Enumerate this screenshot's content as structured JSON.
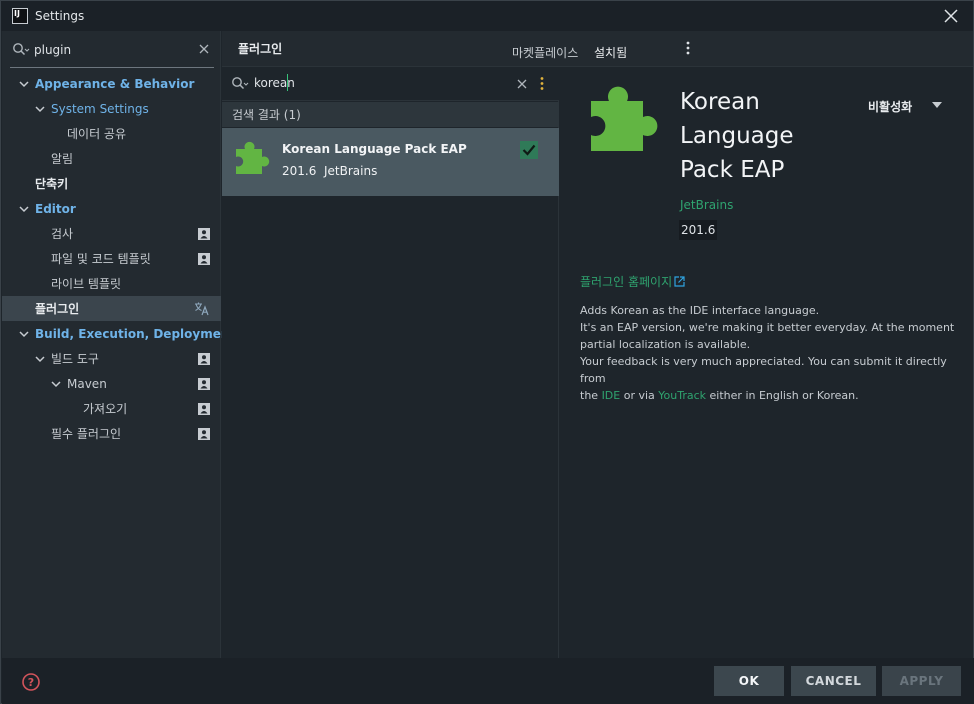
{
  "window": {
    "title": "Settings",
    "app_icon_text": "IJ"
  },
  "left": {
    "search_value": "plugin",
    "tree": [
      {
        "label": "Appearance & Behavior",
        "level": 0,
        "expanded": true,
        "style": "category"
      },
      {
        "label": "System Settings",
        "level": 1,
        "expanded": true,
        "style": "category-sub"
      },
      {
        "label": "데이터 공유",
        "level": 2,
        "style": "plain"
      },
      {
        "label": "알림",
        "level": 1,
        "style": "plain"
      },
      {
        "label": "단축키",
        "level": 0,
        "style": "bold"
      },
      {
        "label": "Editor",
        "level": 0,
        "expanded": true,
        "style": "category"
      },
      {
        "label": "검사",
        "level": 1,
        "style": "plain",
        "icon": "profile-icon"
      },
      {
        "label": "파일 및 코드 템플릿",
        "level": 1,
        "style": "plain",
        "icon": "profile-icon"
      },
      {
        "label": "라이브 템플릿",
        "level": 1,
        "style": "plain"
      },
      {
        "label": "플러그인",
        "level": 0,
        "style": "bold",
        "selected": true,
        "icon": "translate-icon"
      },
      {
        "label": "Build, Execution, Deployment",
        "level": 0,
        "expanded": true,
        "style": "category"
      },
      {
        "label": "빌드 도구",
        "level": 1,
        "expanded": true,
        "style": "plain",
        "icon": "profile-icon"
      },
      {
        "label": "Maven",
        "level": 2,
        "expanded": true,
        "style": "plain",
        "icon": "profile-icon"
      },
      {
        "label": "가져오기",
        "level": 3,
        "style": "plain",
        "icon": "profile-icon"
      },
      {
        "label": "필수 플러그인",
        "level": 1,
        "style": "plain",
        "icon": "profile-icon"
      }
    ]
  },
  "main": {
    "title": "플러그인",
    "tabs": [
      {
        "label": "마켓플레이스",
        "active": false
      },
      {
        "label": "설치됨",
        "active": true
      }
    ]
  },
  "plugins_list": {
    "search_value": "korean",
    "results_header": "검색 결과 (1)",
    "items": [
      {
        "name": "Korean Language Pack EAP",
        "version": "201.6",
        "vendor": "JetBrains",
        "enabled": true
      }
    ]
  },
  "detail": {
    "name_line1": "Korean",
    "name_line2": "Language",
    "name_line3": "Pack EAP",
    "disable_label": "비활성화",
    "vendor": "JetBrains",
    "version": "201.6",
    "homepage_label": "플러그인 홈페이지",
    "desc_line1": "Adds Korean as the IDE interface language.",
    "desc_line2": "It's an EAP version, we're making it better everyday. At the moment",
    "desc_line3": "partial localization is available.",
    "desc_line4": "Your feedback is very much appreciated. You can submit it directly from",
    "desc_line5_pre": "the ",
    "desc_line5_link1": "IDE",
    "desc_line5_mid": " or via ",
    "desc_line5_link2": "YouTrack",
    "desc_line5_post": " either in English or Korean."
  },
  "footer": {
    "ok_label": "OK",
    "cancel_label": "CANCEL",
    "apply_label": "APPLY"
  },
  "colors": {
    "accent_green": "#2fa36f",
    "category_blue": "#6fb3e8",
    "puzzle_green": "#62b543",
    "selected_row": "#3b454d",
    "selected_item": "#4a5961"
  }
}
